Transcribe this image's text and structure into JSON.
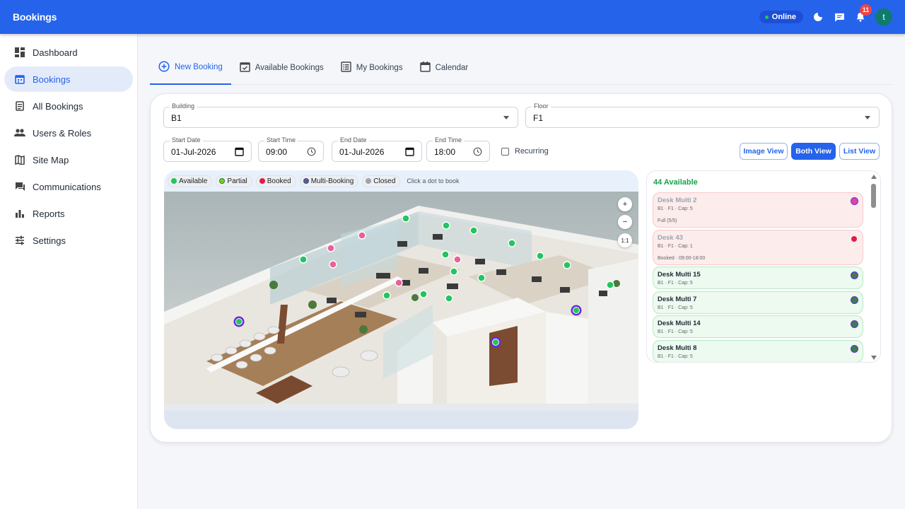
{
  "app": {
    "title": "Bookings"
  },
  "header": {
    "status": "Online",
    "notifications": "11",
    "avatar_initial": "t"
  },
  "sidebar": {
    "items": [
      {
        "label": "Dashboard",
        "icon": "dashboard-icon"
      },
      {
        "label": "Bookings",
        "icon": "calendar-icon",
        "active": true
      },
      {
        "label": "All Bookings",
        "icon": "book-icon"
      },
      {
        "label": "Users & Roles",
        "icon": "people-icon"
      },
      {
        "label": "Site Map",
        "icon": "map-icon"
      },
      {
        "label": "Communications",
        "icon": "chat-icon"
      },
      {
        "label": "Reports",
        "icon": "chart-icon"
      },
      {
        "label": "Settings",
        "icon": "sliders-icon"
      }
    ]
  },
  "tabs": [
    {
      "label": "New Booking",
      "icon": "plus-circle-icon"
    },
    {
      "label": "Available Bookings",
      "icon": "calendar-check-icon"
    },
    {
      "label": "My Bookings",
      "icon": "list-icon"
    },
    {
      "label": "Calendar",
      "icon": "calendar-icon"
    }
  ],
  "form": {
    "building": {
      "label": "Building",
      "value": "B1"
    },
    "floor": {
      "label": "Floor",
      "value": "F1"
    },
    "start_date": {
      "label": "Start Date",
      "value": "01-Jul-2026"
    },
    "start_time": {
      "label": "Start Time",
      "value": "09:00"
    },
    "end_date": {
      "label": "End Date",
      "value": "01-Jul-2026"
    },
    "end_time": {
      "label": "End Time",
      "value": "18:00"
    },
    "recurring": "Recurring"
  },
  "views": {
    "image": "Image View",
    "both": "Both View",
    "list": "List View"
  },
  "legend": {
    "available": "Available",
    "partial": "Partial",
    "booked": "Booked",
    "multi": "Multi-Booking",
    "closed": "Closed",
    "hint": "Click a dot to book"
  },
  "zoom": {
    "in": "+",
    "out": "−",
    "reset": "1:1"
  },
  "list": {
    "count": "44 Available",
    "desks": [
      {
        "name": "Desk Multi 2",
        "meta": "B1 · F1 · Cap: 5",
        "status": "Full (5/5)",
        "state": "booked",
        "dot": "#d946a8"
      },
      {
        "name": "Desk 43",
        "meta": "B1 · F1 · Cap: 1",
        "status": "Booked · 09:00-18:00",
        "state": "booked",
        "dot": "#e11d48"
      },
      {
        "name": "Desk Multi 15",
        "meta": "B1 · F1 · Cap: 5",
        "status": "",
        "state": "avail",
        "dot": "#3b7d4f"
      },
      {
        "name": "Desk Multi 7",
        "meta": "B1 · F1 · Cap: 5",
        "status": "",
        "state": "avail",
        "dot": "#3b7d4f"
      },
      {
        "name": "Desk Multi 14",
        "meta": "B1 · F1 · Cap: 5",
        "status": "",
        "state": "avail",
        "dot": "#3b7d4f"
      },
      {
        "name": "Desk Multi 8",
        "meta": "B1 · F1 · Cap: 5",
        "status": "",
        "state": "avail",
        "dot": "#3b7d4f"
      }
    ]
  },
  "colors": {
    "primary": "#2563eb",
    "available": "#22c55e",
    "booked": "#e11d48",
    "multi": "#6d28d9",
    "closed": "#9ca3af"
  }
}
